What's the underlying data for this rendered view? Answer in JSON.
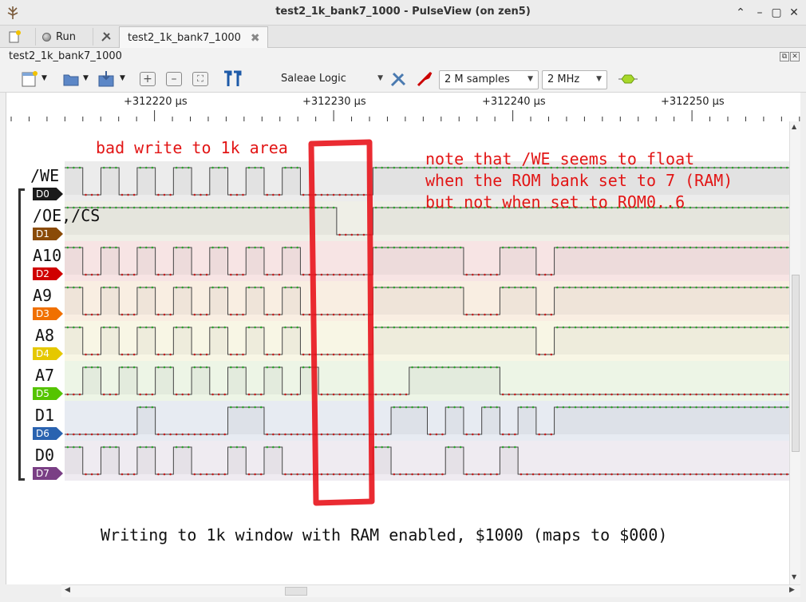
{
  "window": {
    "title": "test2_1k_bank7_1000 - PulseView (on zen5)"
  },
  "tabbar": {
    "run_label": "Run",
    "doc_tab": "test2_1k_bank7_1000"
  },
  "doc": {
    "label": "test2_1k_bank7_1000"
  },
  "toolbar": {
    "device": "Saleae Logic",
    "samples": "2 M samples",
    "rate": "2 MHz"
  },
  "ruler": {
    "ticks": [
      "+312220 µs",
      "+312230 µs",
      "+312240 µs",
      "+312250 µs"
    ]
  },
  "channels": [
    {
      "name": "/WE",
      "badge": "D0",
      "color": "#1a1a1a",
      "bg": "#ececec",
      "trace": "1 0 1 0 1 0 1 0 1 0 1 0 1 0 0 0 0 1 1 1 1 1 1 1 1 1 1 1 1 1 1 1 1 1 1 1 1 1 1 1"
    },
    {
      "name": "/OE,/CS",
      "badge": "D1",
      "color": "#8a4b08",
      "bg": "#efefe7",
      "trace": "1 1 1 1 1 1 1 1 1 1 1 1 1 1 1 0 0 1 1 1 1 1 1 1 1 1 1 1 1 1 1 1 1 1 1 1 1 1 1 1"
    },
    {
      "name": "A10",
      "badge": "D2",
      "color": "#d00000",
      "bg": "#f7e4e4",
      "trace": "1 0 1 0 1 0 1 0 1 0 1 0 1 0 0 0 0 1 1 1 1 1 0 0 1 1 0 1 1 1 1 1 1 1 1 1 1 1 1 1"
    },
    {
      "name": "A9",
      "badge": "D3",
      "color": "#f07000",
      "bg": "#f9eee2",
      "trace": "1 0 1 0 1 0 1 0 1 0 1 0 1 0 0 0 0 1 1 1 1 1 0 0 1 1 0 1 1 1 1 1 1 1 1 1 1 1 1 1"
    },
    {
      "name": "A8",
      "badge": "D4",
      "color": "#e5c800",
      "bg": "#f8f6e5",
      "trace": "1 0 1 0 1 0 1 0 1 0 1 0 1 0 0 0 0 1 1 1 1 1 1 1 1 1 0 1 1 1 1 1 1 1 1 1 1 1 1 1"
    },
    {
      "name": "A7",
      "badge": "D5",
      "color": "#55c400",
      "bg": "#edf5e6",
      "trace": "0 1 0 1 0 1 0 1 0 1 0 1 0 1 0 0 0 0 0 1 1 1 1 1 0 0 0 0 0 0 0 0 0 0 0 0 0 0 0 0"
    },
    {
      "name": "D1",
      "badge": "D6",
      "color": "#2a63b0",
      "bg": "#e7ebf2",
      "trace": "0 0 0 0 1 0 0 0 0 1 1 0 0 0 0 0 0 0 1 1 0 1 0 1 0 1 0 1 1 1 1 1 1 1 1 1 1 1 1 1"
    },
    {
      "name": "D0",
      "badge": "D7",
      "color": "#7a3f85",
      "bg": "#efebf1",
      "trace": "1 0 1 0 1 0 1 0 0 1 0 1 0 0 0 0 0 1 0 0 0 1 0 0 1 0 0 0 0 0 0 0 0 0 0 0 0 0 0 0"
    }
  ],
  "annotations": {
    "bad_write": "bad write to 1k area",
    "note": "note that /WE seems to float\nwhen the ROM bank set to 7 (RAM)\nbut not when set to ROM0..6",
    "caption": "Writing to 1k window with RAM enabled, $1000 (maps to $000)"
  }
}
